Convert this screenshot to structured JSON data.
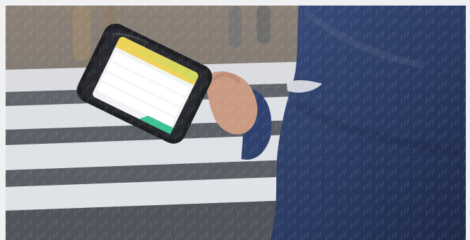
{
  "image": {
    "subject": "person-holding-rugged-tablet-in-rain",
    "background": "crosswalk-stripes",
    "accent_colors": {
      "coat": "#2e3e66",
      "tablet_body": "#1d1f22",
      "screen_header": "#e7d14a",
      "screen_footer": "#32c08e",
      "stripe_light": "#dfe2e6",
      "stripe_dark": "#5c6168"
    }
  },
  "tablet_screen": {
    "header_text": "",
    "rows": [
      {
        "label": "",
        "value": ""
      },
      {
        "label": "",
        "value": ""
      },
      {
        "label": "",
        "value": ""
      },
      {
        "label": "",
        "value": ""
      }
    ],
    "footer_text": ""
  }
}
